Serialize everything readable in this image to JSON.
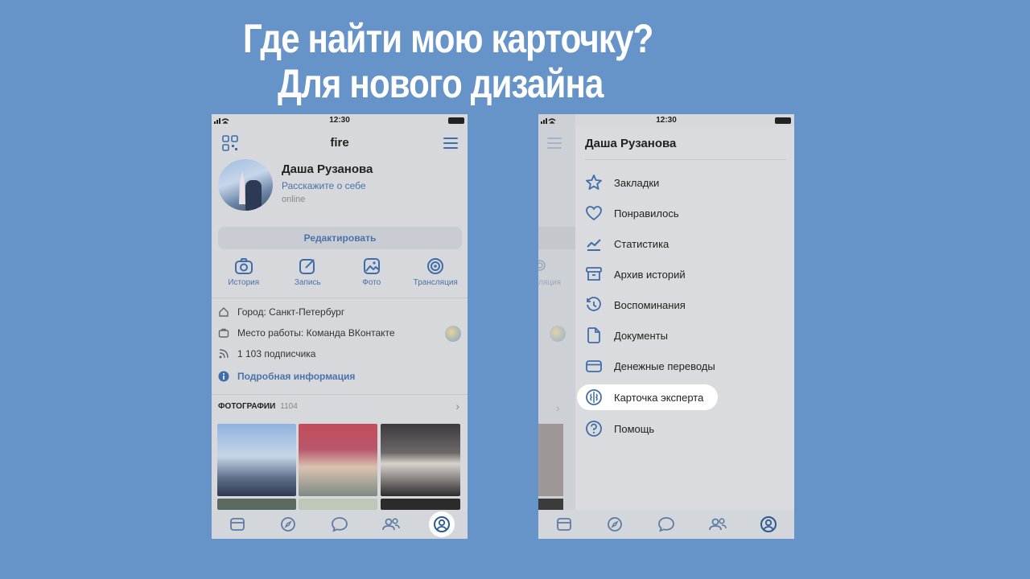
{
  "heading": {
    "line1": "Где найти мою карточку?",
    "line2": "Для нового дизайна"
  },
  "status": {
    "time": "12:30"
  },
  "profile_screen": {
    "header_title": "fire",
    "user_name": "Даша Рузанова",
    "about": "Расскажите о себе",
    "online": "online",
    "edit_button": "Редактировать",
    "actions": [
      {
        "label": "История",
        "icon": "camera-icon"
      },
      {
        "label": "Запись",
        "icon": "edit-icon"
      },
      {
        "label": "Фото",
        "icon": "image-icon"
      },
      {
        "label": "Трансляция",
        "icon": "broadcast-icon"
      }
    ],
    "info": {
      "city": "Город: Санкт-Петербург",
      "work": "Место работы: Команда ВКонтакте",
      "followers": "1 103 подписчика",
      "details": "Подробная информация"
    },
    "photos_label": "ФОТОГРАФИИ",
    "photos_count": "1104"
  },
  "menu_screen": {
    "user_name": "Даша Рузанова",
    "ghost_label": "ляция",
    "items": [
      {
        "label": "Закладки",
        "icon": "star-icon"
      },
      {
        "label": "Понравилось",
        "icon": "heart-icon"
      },
      {
        "label": "Статистика",
        "icon": "stats-icon"
      },
      {
        "label": "Архив историй",
        "icon": "archive-icon"
      },
      {
        "label": "Воспоминания",
        "icon": "history-icon"
      },
      {
        "label": "Документы",
        "icon": "document-icon"
      },
      {
        "label": "Денежные переводы",
        "icon": "card-icon"
      },
      {
        "label": "Карточка эксперта",
        "icon": "expert-card-icon",
        "highlighted": true
      },
      {
        "label": "Помощь",
        "icon": "help-icon"
      }
    ]
  },
  "tab_icons": [
    "newsfeed-icon",
    "discover-icon",
    "messages-icon",
    "friends-icon",
    "profile-icon"
  ],
  "colors": {
    "background": "#6693c8",
    "accent": "#4a72a8",
    "icon": "#3f6da8"
  }
}
